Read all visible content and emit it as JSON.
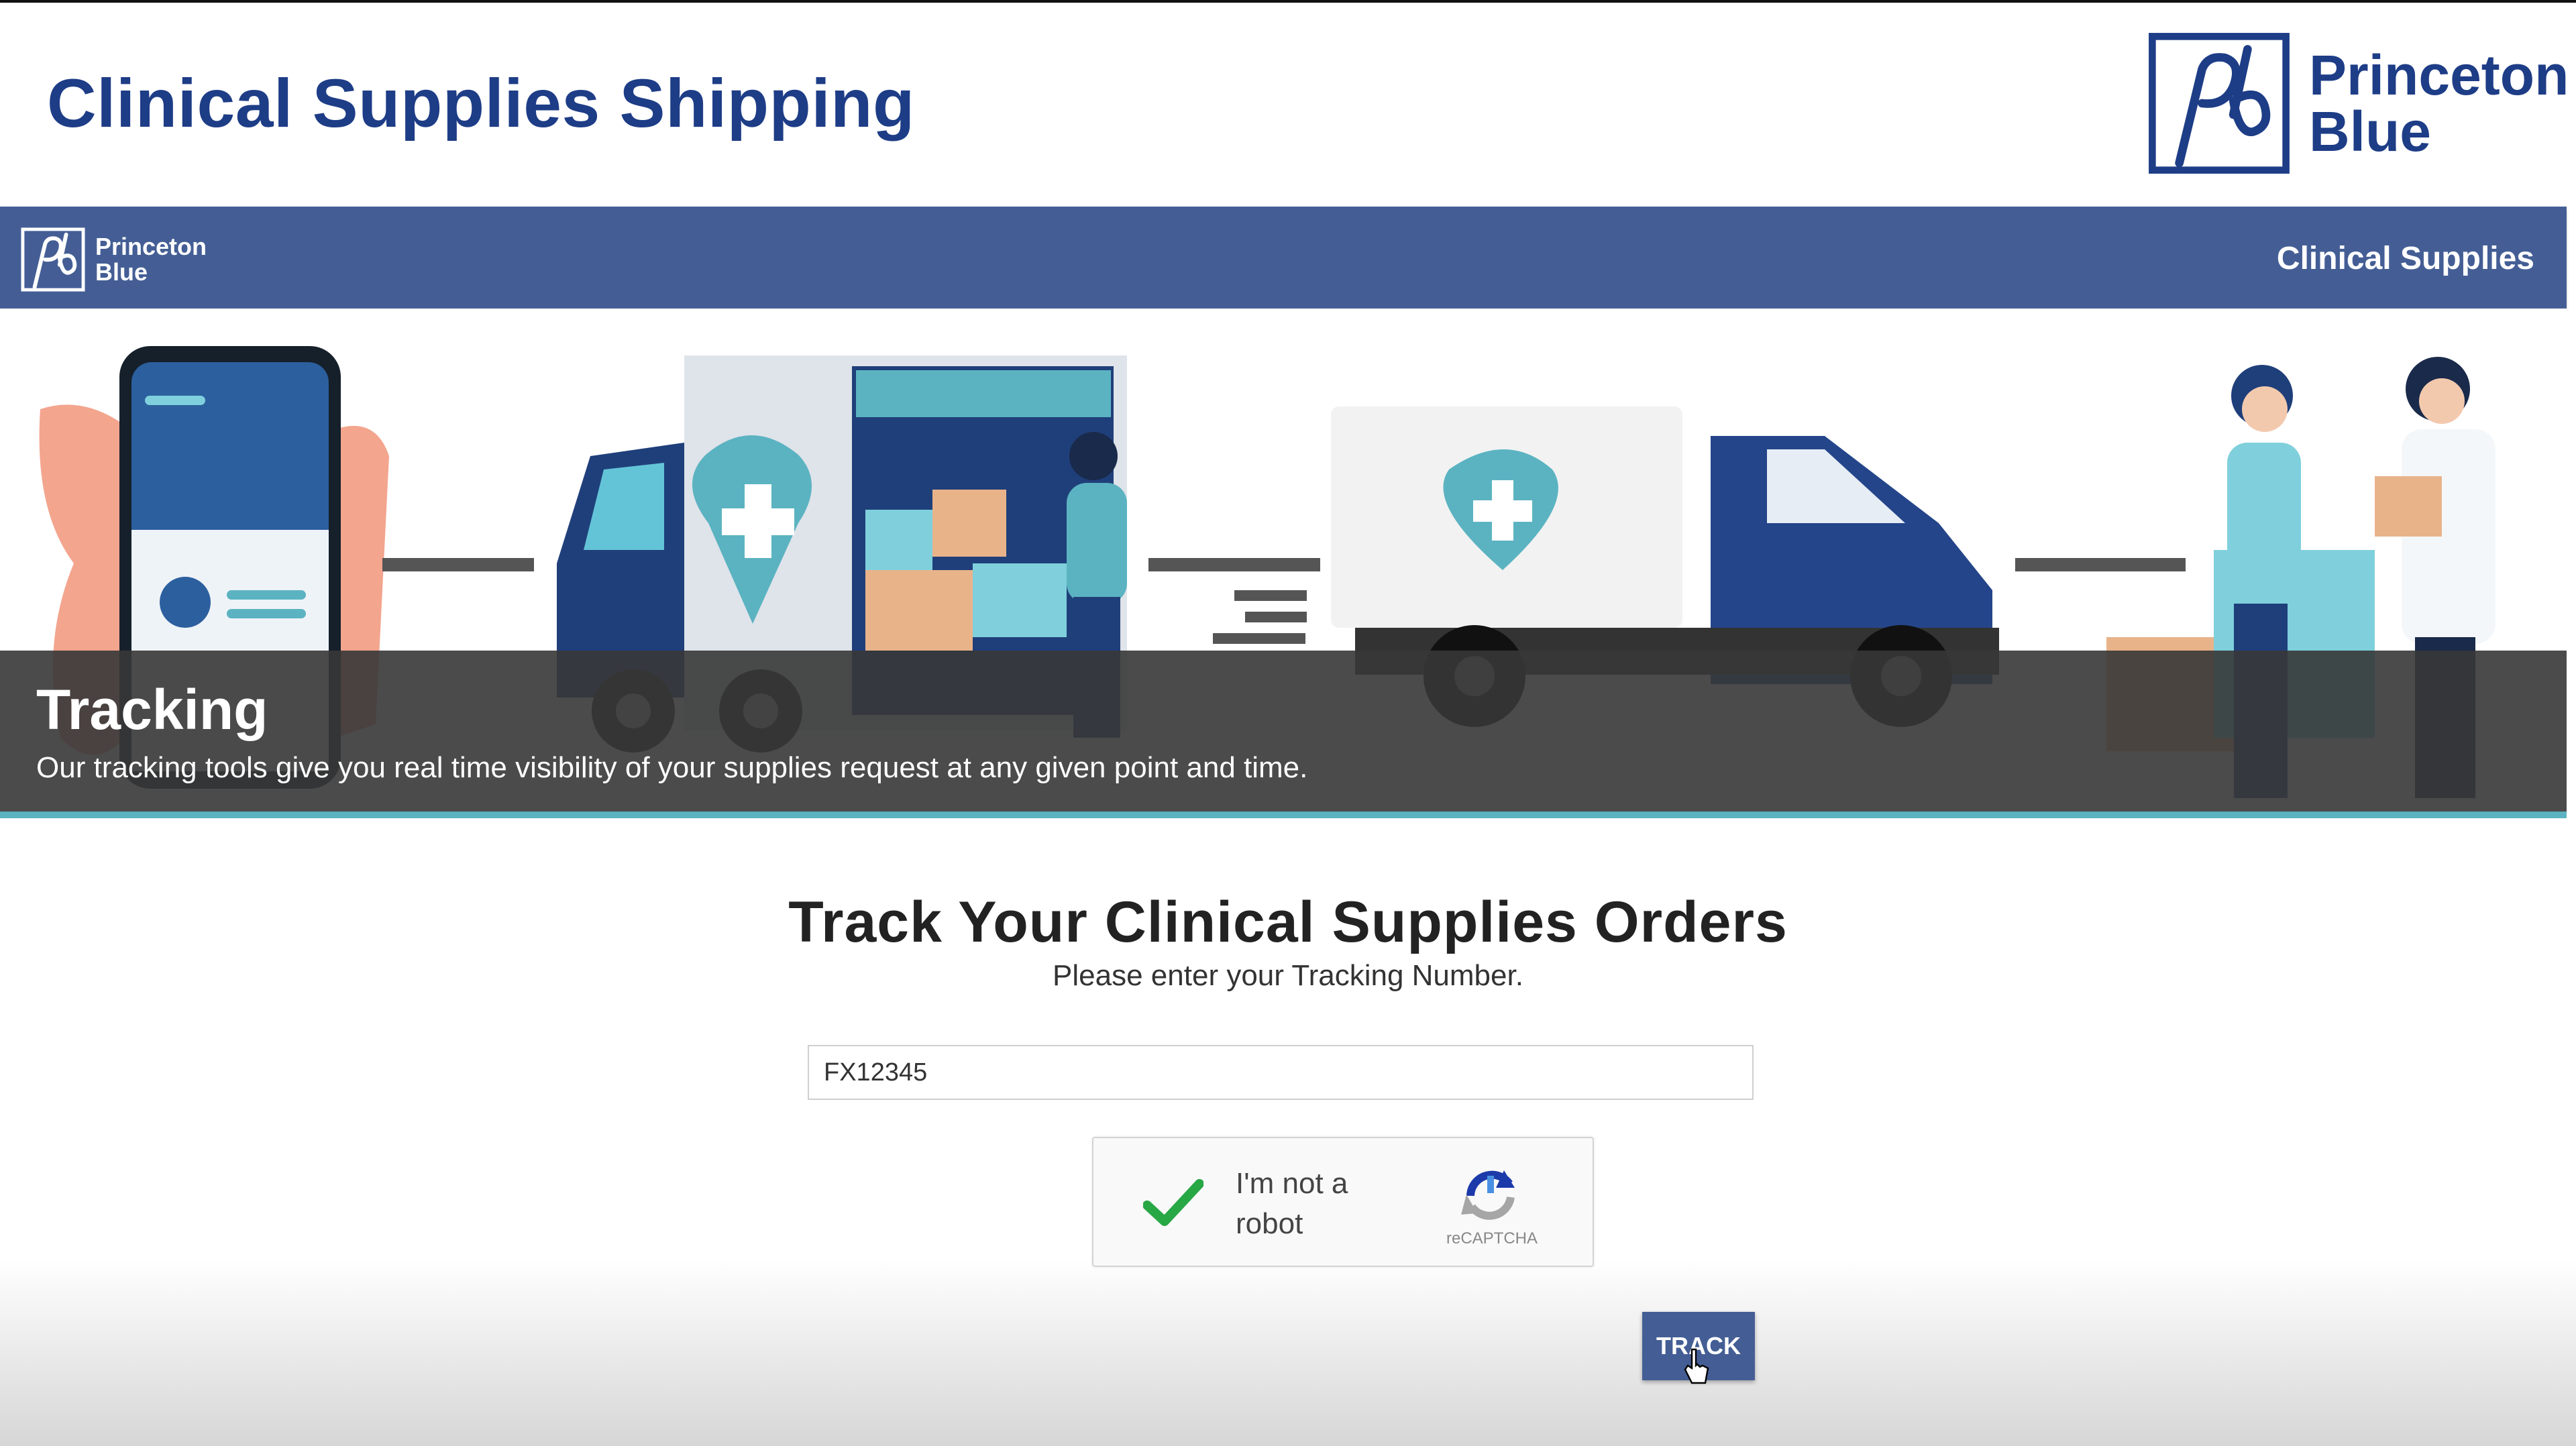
{
  "header": {
    "title": "Clinical Supplies Shipping",
    "brand_line1": "Princeton",
    "brand_line2": "Blue"
  },
  "nav": {
    "brand_line1": "Princeton",
    "brand_line2": "Blue",
    "link": "Clinical Supplies"
  },
  "hero": {
    "title": "Tracking",
    "description": "Our tracking tools give you real time visibility of your supplies request at any given point and time."
  },
  "main": {
    "heading": "Track Your Clinical Supplies Orders",
    "subheading": "Please enter your Tracking Number.",
    "tracking_value": "FX12345",
    "captcha_label": "I'm not a robot",
    "captcha_brand": "reCAPTCHA",
    "track_button": "TRACK"
  },
  "colors": {
    "brand_blue": "#1e3d87",
    "nav_blue": "#445e95",
    "accent_teal": "#5bb3c1",
    "check_green": "#28a745"
  },
  "icons": [
    "pb-logo-icon",
    "check-icon",
    "recaptcha-icon",
    "cursor-icon"
  ]
}
